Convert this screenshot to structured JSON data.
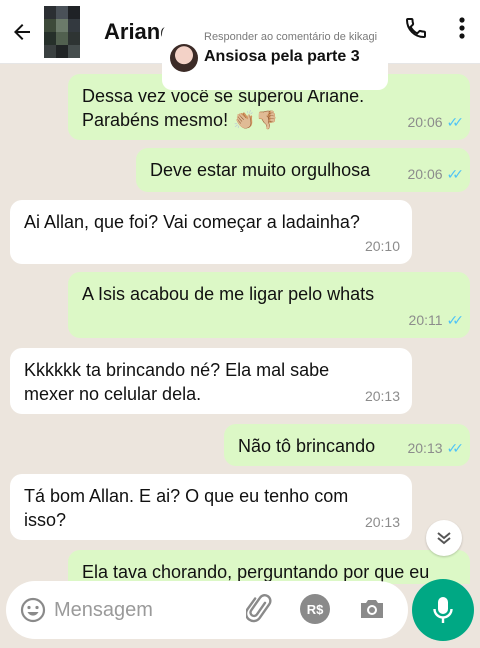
{
  "header": {
    "contact_name": "Ariane",
    "back_icon": "arrow-left-icon",
    "call_icon": "phone-icon",
    "menu_icon": "more-vertical-icon"
  },
  "reply_overlay": {
    "label": "Responder ao comentário de kikagi",
    "comment": "Ansiosa pela parte 3"
  },
  "messages": [
    {
      "direction": "out",
      "text": "Dessa vez você se superou Ariane. Parabéns mesmo! 👏🏼👎🏼",
      "time": "20:06",
      "read": true
    },
    {
      "direction": "out",
      "text": "Deve estar muito orgulhosa",
      "time": "20:06",
      "read": true
    },
    {
      "direction": "in",
      "text": "Ai Allan, que foi? Vai começar a ladainha?",
      "time": "20:10"
    },
    {
      "direction": "out",
      "text": "A Isis acabou de me ligar pelo whats",
      "time": "20:11",
      "read": true
    },
    {
      "direction": "in",
      "text": "Kkkkkk ta brincando né? Ela mal sabe mexer no celular dela.",
      "time": "20:13"
    },
    {
      "direction": "out",
      "text": "Não tô brincando",
      "time": "20:13",
      "read": true
    },
    {
      "direction": "in",
      "text": "Tá bom Allan. E ai? O que eu tenho com isso?",
      "time": "20:13"
    },
    {
      "direction": "out",
      "text": "Ela tava chorando, perguntando por que eu",
      "time": ""
    }
  ],
  "input": {
    "placeholder": "Mensagem",
    "icons": [
      "emoji-icon",
      "attachment-icon",
      "payment-icon",
      "camera-icon"
    ],
    "payment_label": "R$",
    "mic_icon": "microphone-icon"
  },
  "colors": {
    "outgoing_bubble": "#dcf8c6",
    "incoming_bubble": "#ffffff",
    "chat_background": "#ece5dd",
    "accent": "#00a884",
    "read_ticks": "#4fc3f7"
  }
}
